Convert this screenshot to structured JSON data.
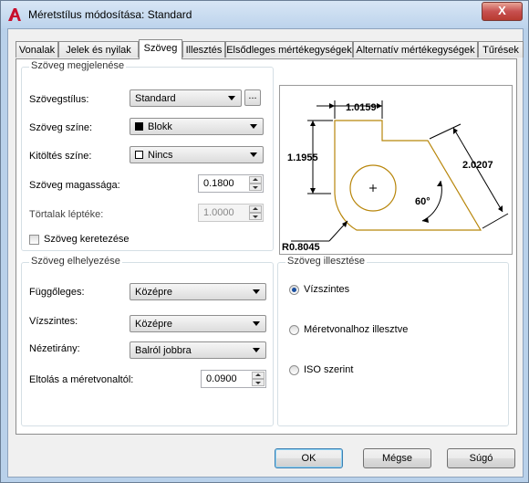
{
  "window": {
    "title": "Méretstílus módosítása: Standard",
    "close_glyph": "X"
  },
  "tabs": [
    {
      "label": "Vonalak"
    },
    {
      "label": "Jelek és nyilak"
    },
    {
      "label": "Szöveg"
    },
    {
      "label": "Illesztés"
    },
    {
      "label": "Elsődleges mértékegységek"
    },
    {
      "label": "Alternatív mértékegységek"
    },
    {
      "label": "Tűrések"
    }
  ],
  "appearance": {
    "title": "Szöveg megjelenése",
    "style_label": "Szövegstílus:",
    "style_value": "Standard",
    "browse": "...",
    "color_label": "Szöveg színe:",
    "color_value": "Blokk",
    "color_swatch": "#000000",
    "fill_label": "Kitöltés színe:",
    "fill_value": "Nincs",
    "fill_swatch": "#ffffff",
    "height_label": "Szöveg magassága:",
    "height_value": "0.1800",
    "fraction_label": "Törtalak léptéke:",
    "fraction_value": "1.0000",
    "frame_label": "Szöveg keretezése",
    "frame_checked": false
  },
  "preview": {
    "dim_top": "1.0159",
    "dim_left": "1.1955",
    "dim_right": "2.0207",
    "angle": "60°",
    "radius": "R0.8045",
    "outline_color": "#b8860b"
  },
  "placement": {
    "title": "Szöveg elhelyezése",
    "vertical_label": "Függőleges:",
    "vertical_value": "Középre",
    "horizontal_label": "Vízszintes:",
    "horizontal_value": "Középre",
    "direction_label": "Nézetirány:",
    "direction_value": "Balról jobbra",
    "offset_label": "Eltolás a méretvonaltól:",
    "offset_value": "0.0900"
  },
  "alignment": {
    "title": "Szöveg illesztése",
    "options": [
      {
        "label": "Vízszintes",
        "selected": true
      },
      {
        "label": "Méretvonalhoz illesztve",
        "selected": false
      },
      {
        "label": "ISO szerint",
        "selected": false
      }
    ]
  },
  "buttons": {
    "ok": "OK",
    "cancel": "Mégse",
    "help": "Súgó"
  }
}
